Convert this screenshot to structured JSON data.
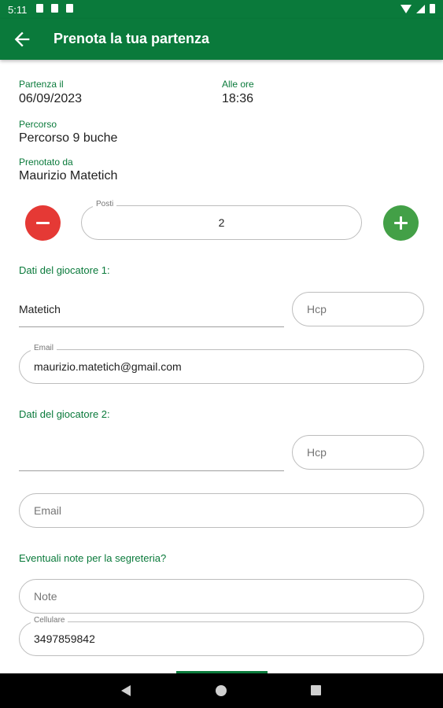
{
  "status_bar": {
    "time": "5:11"
  },
  "app_bar": {
    "title": "Prenota la tua partenza"
  },
  "booking": {
    "date_label": "Partenza il",
    "date_value": "06/09/2023",
    "time_label": "Alle ore",
    "time_value": "18:36",
    "course_label": "Percorso",
    "course_value": "Percorso 9 buche",
    "booked_by_label": "Prenotato da",
    "booked_by_value": "Maurizio Matetich"
  },
  "seats": {
    "label": "Posti",
    "value": "2"
  },
  "player1": {
    "section_label": "Dati del giocatore 1:",
    "name_value": "Matetich",
    "hcp_placeholder": "Hcp",
    "email_label": "Email",
    "email_value": "maurizio.matetich@gmail.com"
  },
  "player2": {
    "section_label": "Dati del giocatore 2:",
    "name_value": "",
    "hcp_placeholder": "Hcp",
    "email_placeholder": "Email"
  },
  "notes": {
    "section_label": "Eventuali note per la segreteria?",
    "notes_placeholder": "Note",
    "phone_label": "Cellulare",
    "phone_value": "3497859842"
  },
  "colors": {
    "primary": "#0a7a3b",
    "minus_button": "#e53935",
    "plus_button": "#43a047"
  },
  "icons": {
    "back": "arrow-left-icon",
    "minus": "minus-icon",
    "plus": "plus-icon"
  }
}
